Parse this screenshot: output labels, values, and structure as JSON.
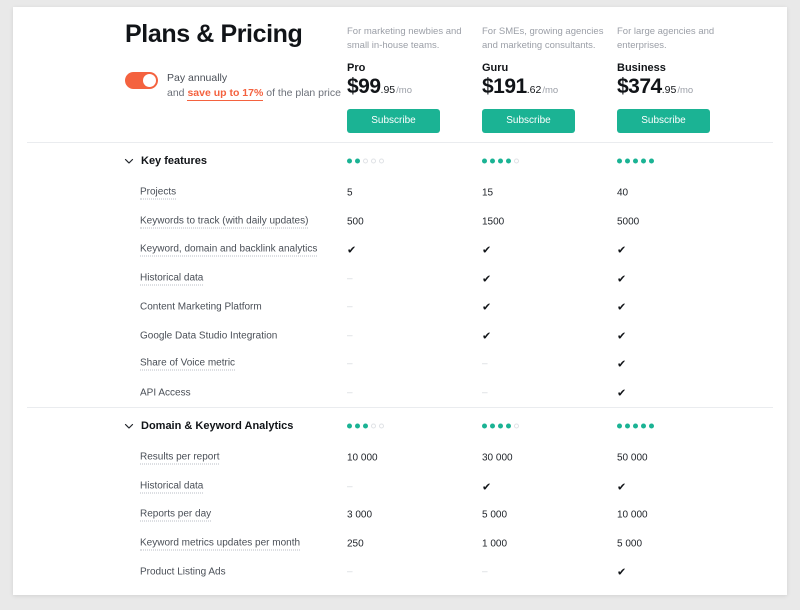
{
  "header": {
    "title": "Plans & Pricing",
    "billing_toggle": {
      "state_on": true,
      "label": "Pay annually",
      "sub_prefix": "and ",
      "sub_highlight": "save up to 17%",
      "sub_suffix": " of the plan price"
    }
  },
  "plans": [
    {
      "id": "pro",
      "description": "For marketing newbies and small in-house teams.",
      "name": "Pro",
      "price_main": "$99",
      "price_cents": ".95",
      "price_period": "/mo",
      "cta": "Subscribe"
    },
    {
      "id": "guru",
      "description": "For SMEs, growing agencies and marketing consultants.",
      "name": "Guru",
      "price_main": "$191",
      "price_cents": ".62",
      "price_period": "/mo",
      "cta": "Subscribe"
    },
    {
      "id": "business",
      "description": "For large agencies and enterprises.",
      "name": "Business",
      "price_main": "$374",
      "price_cents": ".95",
      "price_period": "/mo",
      "cta": "Subscribe"
    }
  ],
  "colors": {
    "accent_green": "#1bb394",
    "accent_orange": "#f4623f",
    "text_dark": "#111418",
    "text_muted": "#9b9fa7",
    "divider": "#eaecef"
  },
  "icons": {
    "chevron": "chevron-down-icon",
    "check": "✔",
    "dash": "–"
  },
  "sections": [
    {
      "title": "Key features",
      "expanded": true,
      "ratings": [
        2,
        4,
        5
      ],
      "rating_max": 5,
      "rows": [
        {
          "label": "Projects",
          "tooltip": true,
          "values": [
            "5",
            "15",
            "40"
          ]
        },
        {
          "label": "Keywords to track (with daily updates)",
          "tooltip": true,
          "values": [
            "500",
            "1500",
            "5000"
          ]
        },
        {
          "label": "Keyword, domain and backlink analytics",
          "tooltip": true,
          "values": [
            "✔",
            "✔",
            "✔"
          ]
        },
        {
          "label": "Historical data",
          "tooltip": true,
          "values": [
            "–",
            "✔",
            "✔"
          ]
        },
        {
          "label": "Content Marketing Platform",
          "tooltip": false,
          "values": [
            "–",
            "✔",
            "✔"
          ]
        },
        {
          "label": "Google Data Studio Integration",
          "tooltip": false,
          "values": [
            "–",
            "✔",
            "✔"
          ]
        },
        {
          "label": "Share of Voice metric",
          "tooltip": true,
          "values": [
            "–",
            "–",
            "✔"
          ]
        },
        {
          "label": "API Access",
          "tooltip": false,
          "values": [
            "–",
            "–",
            "✔"
          ]
        }
      ]
    },
    {
      "title": "Domain & Keyword Analytics",
      "expanded": true,
      "ratings": [
        3,
        4,
        5
      ],
      "rating_max": 5,
      "rows": [
        {
          "label": "Results per report",
          "tooltip": true,
          "values": [
            "10 000",
            "30 000",
            "50 000"
          ]
        },
        {
          "label": "Historical data",
          "tooltip": true,
          "values": [
            "–",
            "✔",
            "✔"
          ]
        },
        {
          "label": "Reports per day",
          "tooltip": true,
          "values": [
            "3 000",
            "5 000",
            "10 000"
          ]
        },
        {
          "label": "Keyword metrics updates per month",
          "tooltip": true,
          "values": [
            "250",
            "1 000",
            "5 000"
          ]
        },
        {
          "label": "Product Listing Ads",
          "tooltip": false,
          "values": [
            "–",
            "–",
            "✔"
          ]
        }
      ]
    }
  ]
}
